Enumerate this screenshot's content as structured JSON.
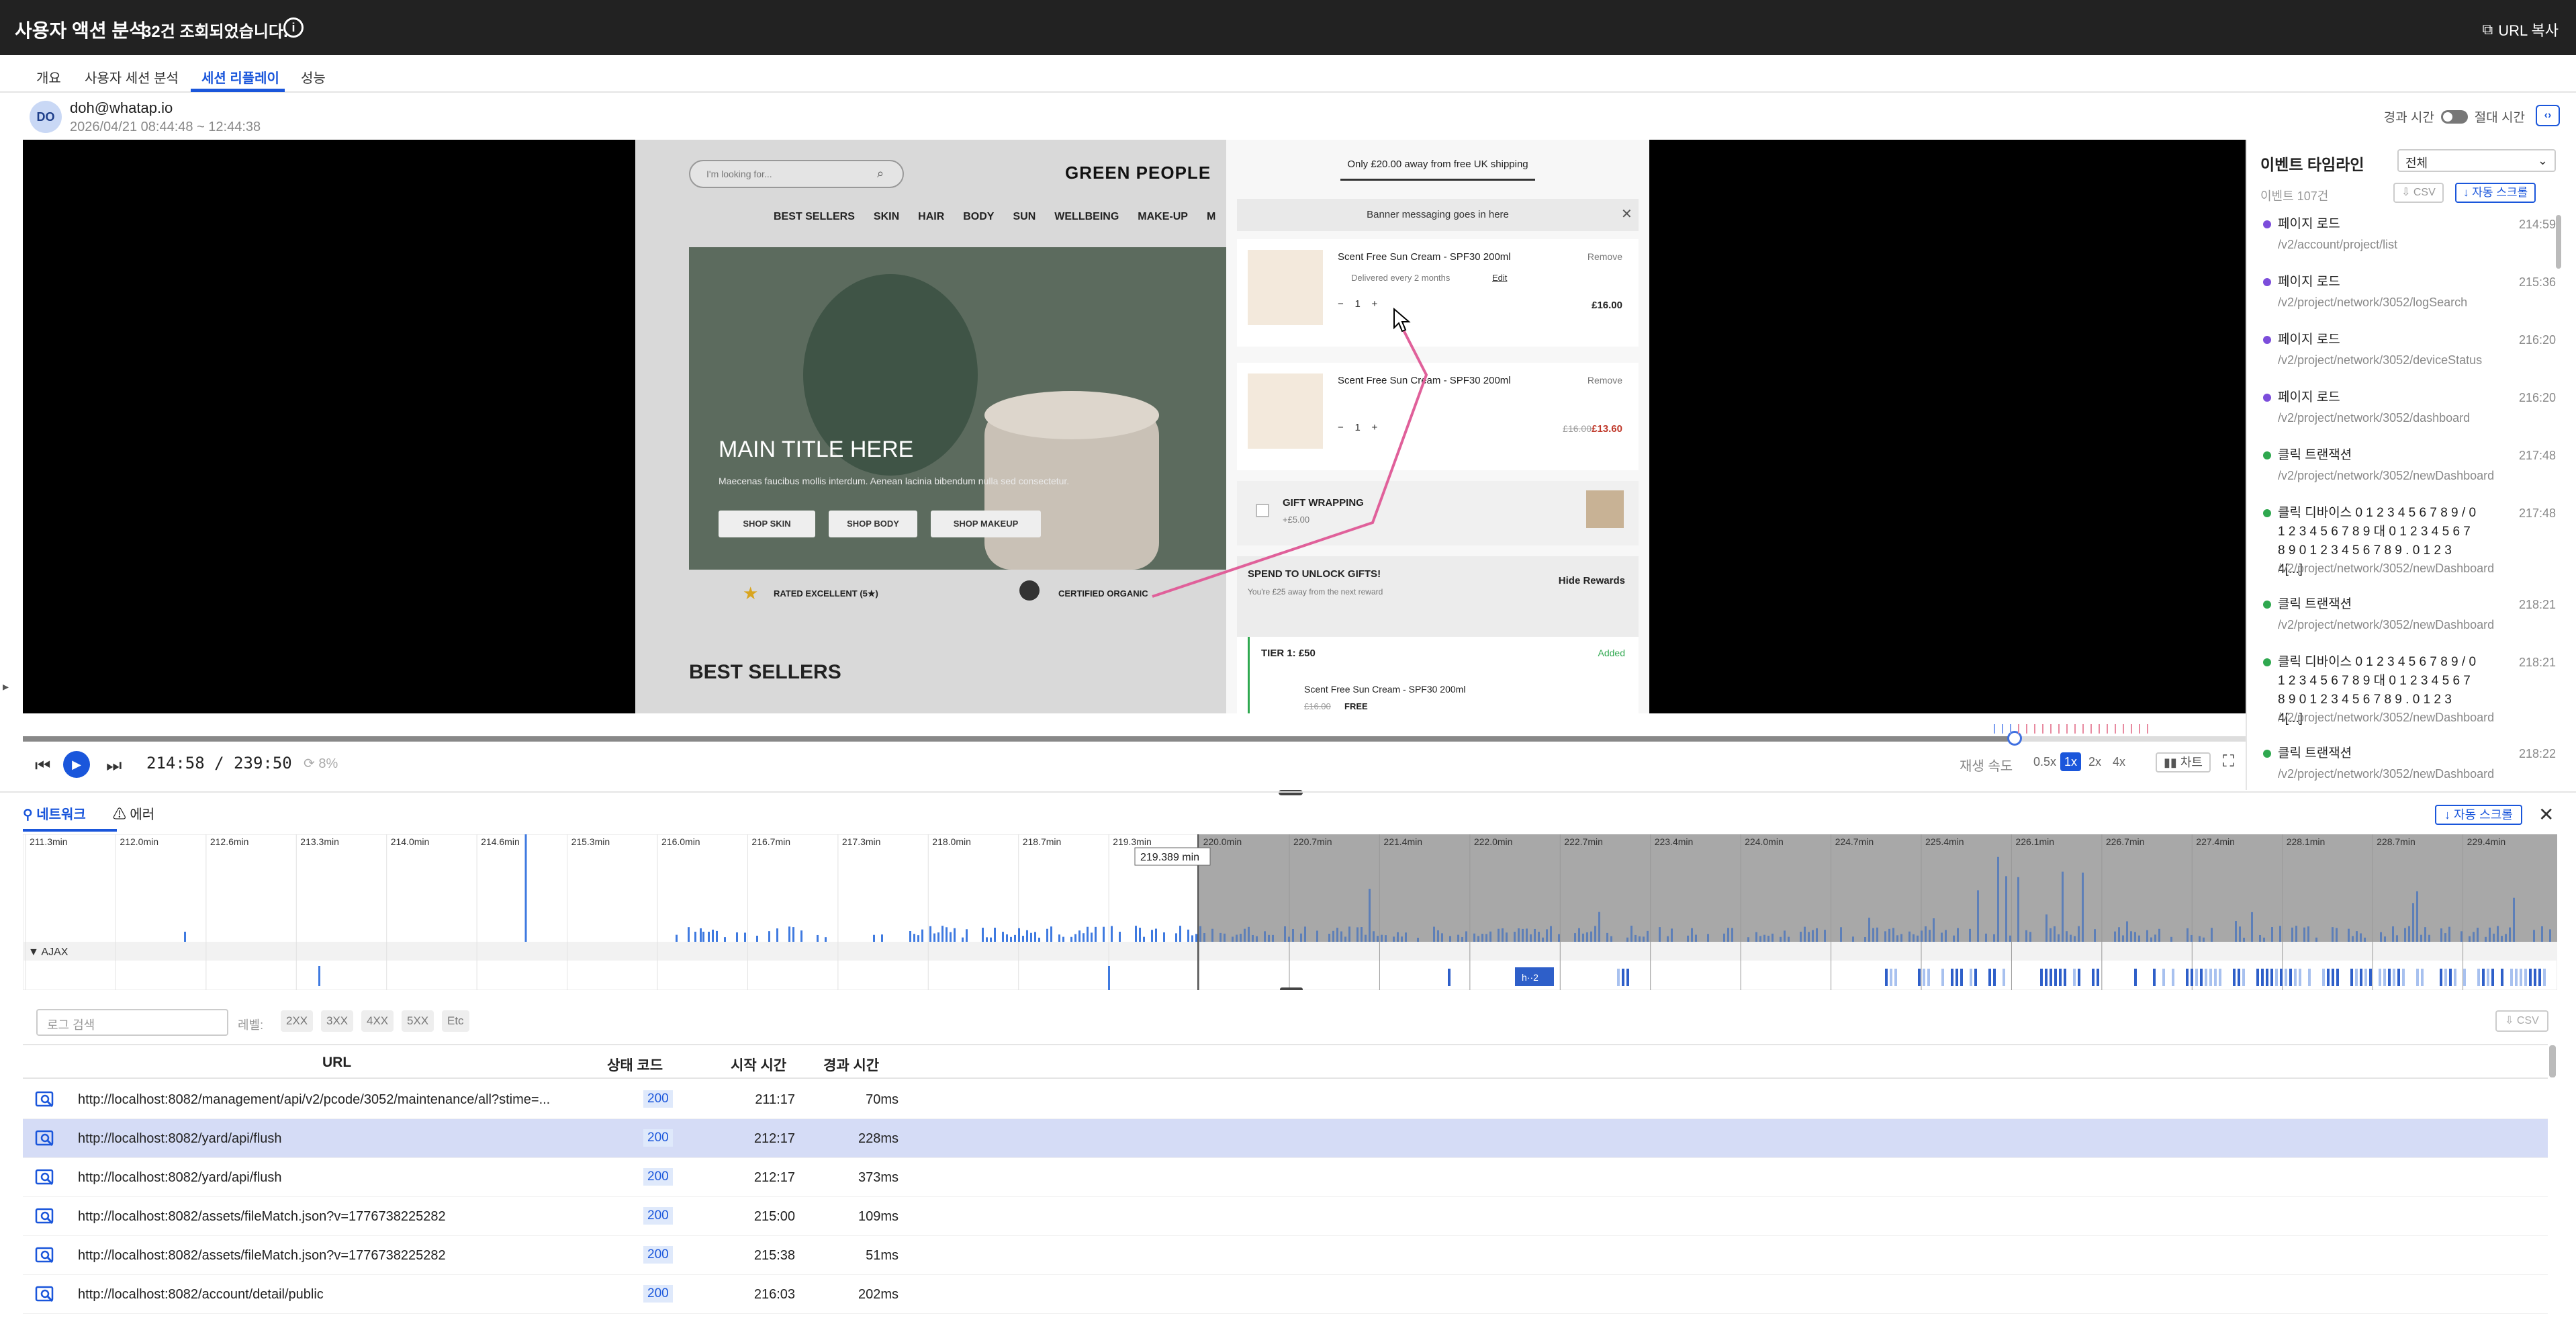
{
  "header": {
    "title": "사용자 액션 분석",
    "count_text": "32건 조회되었습니다.",
    "copy_url": "URL 복사"
  },
  "tabs": [
    "개요",
    "사용자 세션 분석",
    "세션 리플레이",
    "성능"
  ],
  "user": {
    "initials": "DO",
    "email": "doh@whatap.io",
    "date_range": "2026/04/21 08:44:48 ~ 12:44:38"
  },
  "time_toggle": {
    "left": "경과 시간",
    "right": "절대 시간"
  },
  "replay": {
    "search_placeholder": "I'm looking for...",
    "logo": "GREEN PEOPLE",
    "nav": [
      "BEST SELLERS",
      "SKIN",
      "HAIR",
      "BODY",
      "SUN",
      "WELLBEING",
      "MAKE-UP",
      "M"
    ],
    "hero_title": "MAIN TITLE HERE",
    "hero_sub": "Maecenas faucibus mollis interdum. Aenean lacinia bibendum nulla sed consectetur.",
    "hero_buttons": [
      "SHOP SKIN",
      "SHOP BODY",
      "SHOP MAKEUP"
    ],
    "rated": "RATED EXCELLENT (5★)",
    "organic": "CERTIFIED ORGANIC",
    "best_sellers": "BEST SELLERS",
    "shipping": "Only £20.00 away from free UK shipping",
    "banner": "Banner messaging goes in here",
    "item1": {
      "name": "Scent Free Sun Cream - SPF30 200ml",
      "sub": "Delivered every 2 months",
      "edit": "Edit",
      "qty": "1",
      "price": "£16.00",
      "remove": "Remove"
    },
    "item2": {
      "name": "Scent Free Sun Cream - SPF30 200ml",
      "qty": "1",
      "old_price": "£16.00",
      "price": "£13.60",
      "remove": "Remove"
    },
    "gift": {
      "label": "GIFT WRAPPING",
      "price": "+£5.00"
    },
    "unlock": {
      "title": "SPEND TO UNLOCK GIFTS!",
      "sub": "You're £25 away from the next reward",
      "hide": "Hide Rewards"
    },
    "tier": {
      "title": "TIER 1: £50",
      "added": "Added",
      "item": "Scent Free Sun Cream - SPF30 200ml",
      "old": "£16.00",
      "free": "FREE"
    }
  },
  "player": {
    "progress": 0.896,
    "time": "214:58 / 239:50",
    "buffer": "8%",
    "speed_label": "재생 속도",
    "speeds": [
      "0.5x",
      "1x",
      "2x",
      "4x"
    ],
    "active_speed": "1x",
    "chart_btn": "차트"
  },
  "event_timeline": {
    "title": "이벤트 타임라인",
    "filter": "전체",
    "count": "이벤트 107건",
    "csv": "CSV",
    "auto_scroll": "자동 스크롤",
    "events": [
      {
        "type": "load",
        "title": "페이지 로드",
        "time": "214:59",
        "path": "/v2/account/project/list",
        "color": "#7c4ddb"
      },
      {
        "type": "load",
        "title": "페이지 로드",
        "time": "215:36",
        "path": "/v2/project/network/3052/logSearch",
        "color": "#7c4ddb"
      },
      {
        "type": "load",
        "title": "페이지 로드",
        "time": "216:20",
        "path": "/v2/project/network/3052/deviceStatus",
        "color": "#7c4ddb"
      },
      {
        "type": "load",
        "title": "페이지 로드",
        "time": "216:20",
        "path": "/v2/project/network/3052/dashboard",
        "color": "#7c4ddb"
      },
      {
        "type": "click",
        "title": "클릭 트랜잭션",
        "time": "217:48",
        "path": "/v2/project/network/3052/newDashboard",
        "color": "#2fa84f"
      },
      {
        "type": "click",
        "title": "클릭 디바이스 0 1 2 3 4 5 6 7 8 9 / 0 1 2 3 4 5 6 7 8 9 대 0 1 2 3 4 5 6 7 8 9 0 1 2 3 4 5 6 7 8 9 . 0 1 2 3 4[...]",
        "time": "217:48",
        "path": "/v2/project/network/3052/newDashboard",
        "color": "#2fa84f"
      },
      {
        "type": "click",
        "title": "클릭 트랜잭션",
        "time": "218:21",
        "path": "/v2/project/network/3052/newDashboard",
        "color": "#2fa84f"
      },
      {
        "type": "click",
        "title": "클릭 디바이스 0 1 2 3 4 5 6 7 8 9 / 0 1 2 3 4 5 6 7 8 9 대 0 1 2 3 4 5 6 7 8 9 0 1 2 3 4 5 6 7 8 9 . 0 1 2 3 4[...]",
        "time": "218:21",
        "path": "/v2/project/network/3052/newDashboard",
        "color": "#2fa84f"
      },
      {
        "type": "click",
        "title": "클릭 트랜잭션",
        "time": "218:22",
        "path": "/v2/project/network/3052/newDashboard",
        "color": "#2fa84f"
      }
    ]
  },
  "network": {
    "tabs": [
      "네트워크",
      "에러"
    ],
    "auto_scroll": "자동 스크롤",
    "axis_ticks": [
      "211.3min",
      "212.0min",
      "212.6min",
      "213.3min",
      "214.0min",
      "214.6min",
      "215.3min",
      "216.0min",
      "216.7min",
      "217.3min",
      "218.0min",
      "218.7min",
      "219.3min",
      "220.0min",
      "220.7min",
      "221.4min",
      "222.0min",
      "222.7min",
      "223.4min",
      "224.0min",
      "224.7min",
      "225.4min",
      "226.1min",
      "226.7min",
      "227.4min",
      "228.1min",
      "228.7min",
      "229.4min"
    ],
    "cursor_label": "219.389 min",
    "ajax_label": "AJAX",
    "ajax_badge": "h··2",
    "search_placeholder": "로그 검색",
    "level_label": "레벨:",
    "levels": [
      "2XX",
      "3XX",
      "4XX",
      "5XX",
      "Etc"
    ],
    "csv": "CSV",
    "columns": [
      "URL",
      "상태 코드",
      "시작 시간",
      "경과 시간"
    ],
    "rows": [
      {
        "url": "http://localhost:8082/management/api/v2/pcode/3052/maintenance/all?stime=...",
        "status": "200",
        "start": "211:17",
        "duration": "70ms",
        "selected": false
      },
      {
        "url": "http://localhost:8082/yard/api/flush",
        "status": "200",
        "start": "212:17",
        "duration": "228ms",
        "selected": true
      },
      {
        "url": "http://localhost:8082/yard/api/flush",
        "status": "200",
        "start": "212:17",
        "duration": "373ms",
        "selected": false
      },
      {
        "url": "http://localhost:8082/assets/fileMatch.json?v=1776738225282",
        "status": "200",
        "start": "215:00",
        "duration": "109ms",
        "selected": false
      },
      {
        "url": "http://localhost:8082/assets/fileMatch.json?v=1776738225282",
        "status": "200",
        "start": "215:38",
        "duration": "51ms",
        "selected": false
      },
      {
        "url": "http://localhost:8082/account/detail/public",
        "status": "200",
        "start": "216:03",
        "duration": "202ms",
        "selected": false
      }
    ]
  }
}
